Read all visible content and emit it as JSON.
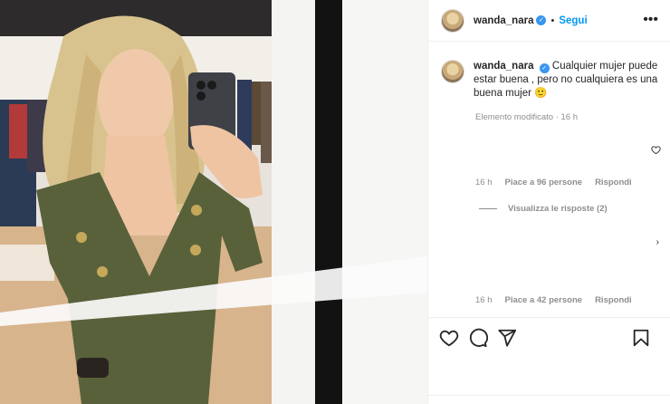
{
  "post": {
    "username": "wanda_nara",
    "verified_mark": "✓",
    "separator": "•",
    "follow_label": "Segui",
    "more_label": "•••",
    "caption": "Cualquier mujer puede estar buena , pero no cualquiera es una buena mujer 🙂",
    "edited_label": "Elemento modificato · 16 h"
  },
  "comments": [
    {
      "time": "16 h",
      "likes": "Piace a 96 persone",
      "reply": "Rispondi",
      "view_replies": "Visualizza le risposte (2)"
    },
    {
      "time": "16 h",
      "likes": "Piace a 42 persone",
      "reply": "Rispondi"
    }
  ],
  "icons": {
    "like": "heart-icon",
    "comment": "comment-icon",
    "share": "share-icon",
    "save": "bookmark-icon"
  }
}
